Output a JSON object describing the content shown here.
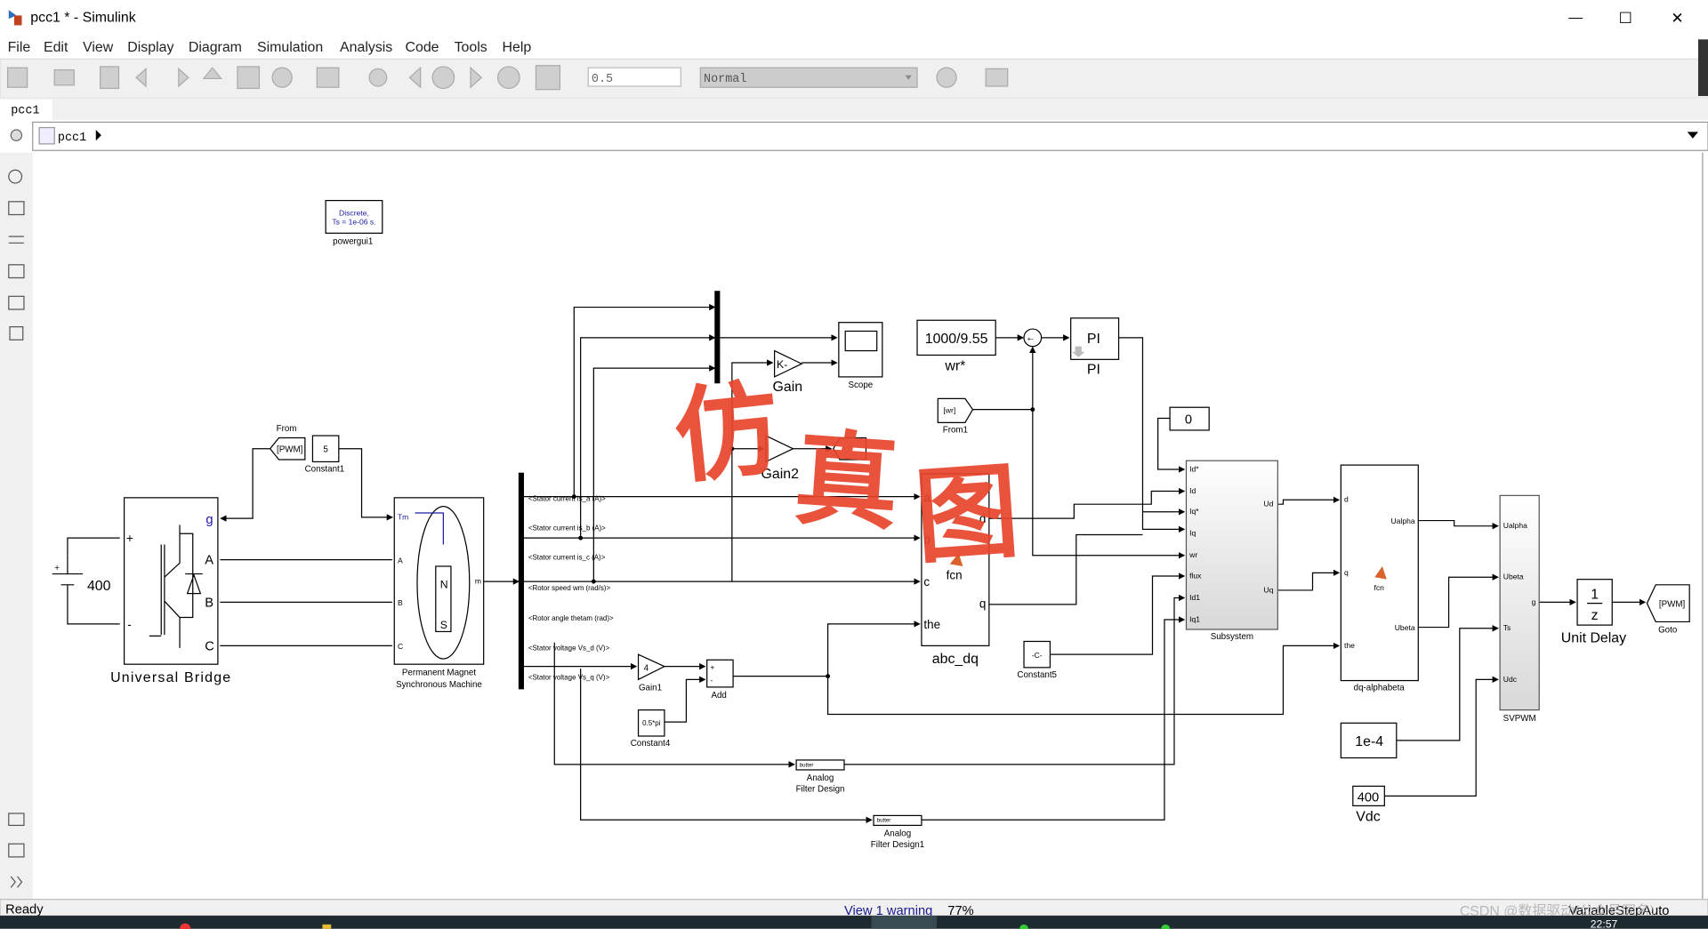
{
  "window": {
    "title": "pcc1 * - Simulink",
    "minimize": "—",
    "maximize": "☐",
    "close": "✕"
  },
  "menu": [
    "File",
    "Edit",
    "View",
    "Display",
    "Diagram",
    "Simulation",
    "Analysis",
    "Code",
    "Tools",
    "Help"
  ],
  "toolbar": {
    "stop_time": "0.5",
    "sim_mode": "Normal"
  },
  "tabs": [
    {
      "label": "pcc1"
    }
  ],
  "breadcrumb": {
    "model": "pcc1"
  },
  "status": {
    "left": "Ready",
    "warning": "View 1 warning",
    "zoom": "77%",
    "solver": "VariableStepAuto",
    "watermark": "CSDN @数据驱动(公众号同名)",
    "clock": "22:57"
  },
  "watermark_text": [
    "仿",
    "真",
    "图"
  ],
  "colors": {
    "accent_blue": "#1a1aa6",
    "watermark_red": "#e8452c",
    "taskbar": "#1d2a30"
  },
  "blocks": {
    "powergui": {
      "line1": "Discrete,",
      "line2": "Ts = 1e-06 s.",
      "label": "powergui1"
    },
    "dc": {
      "value": "400"
    },
    "bridge": {
      "label": "Universal Bridge",
      "ports": [
        "g",
        "A",
        "B",
        "C",
        "+",
        "-"
      ]
    },
    "from": {
      "tag": "[PWM]",
      "label": "From"
    },
    "constant1": {
      "value": "5",
      "label": "Constant1"
    },
    "pmsm": {
      "label1": "Permanent Magnet",
      "label2": "Synchronous Machine",
      "ports": [
        "Tm",
        "A",
        "B",
        "C",
        "m"
      ],
      "poles": [
        "N",
        "S"
      ]
    },
    "bus_signals": [
      "<Stator current is_a (A)>",
      "<Stator current is_b (A)>",
      "<Stator current is_c (A)>",
      "<Rotor speed wm (rad/s)>",
      "<Rotor angle thetam (rad)>",
      "<Stator voltage Vs_d (V)>",
      "<Stator voltage Vs_q (V)>"
    ],
    "scope": {
      "label": "Scope"
    },
    "gain": {
      "value": "K-",
      "label": "Gain"
    },
    "gain2": {
      "label": "Gain2"
    },
    "wr_ref": {
      "value": "1000/9.55",
      "label": "wr*"
    },
    "sum": {
      "signs": "+-"
    },
    "pi": {
      "value": "PI",
      "label": "PI"
    },
    "from1": {
      "tag": "[wr]",
      "label": "From1"
    },
    "zero": {
      "value": "0"
    },
    "abc_dq": {
      "label": "abc_dq",
      "fcn": "fcn",
      "inputs": [
        "a",
        "b",
        "c",
        "the"
      ],
      "outputs": [
        "d",
        "q"
      ]
    },
    "subsystem": {
      "label": "Subsystem",
      "inputs": [
        "Id*",
        "Id",
        "Iq*",
        "Iq",
        "wr",
        "flux",
        "Id1",
        "Iq1"
      ],
      "outputs": [
        "Ud",
        "Uq"
      ]
    },
    "dq_ab": {
      "label": "dq-alphabeta",
      "fcn": "fcn",
      "inputs": [
        "d",
        "q",
        "the"
      ],
      "outputs": [
        "Ualpha",
        "Ubeta"
      ]
    },
    "svpwm": {
      "label": "SVPWM",
      "inputs": [
        "Ualpha",
        "Ubeta",
        "Ts",
        "Udc"
      ],
      "output": "g"
    },
    "unit_delay": {
      "num": "1",
      "den": "z",
      "label": "Unit Delay"
    },
    "goto": {
      "tag": "[PWM]",
      "label": "Goto"
    },
    "ts_const": {
      "value": "1e-4"
    },
    "vdc": {
      "value": "400",
      "label": "Vdc"
    },
    "constant5": {
      "value": "-C-",
      "label": "Constant5"
    },
    "gain1": {
      "value": "4",
      "label": "Gain1"
    },
    "add": {
      "label": "Add",
      "signs": [
        "+",
        "-"
      ]
    },
    "constant4": {
      "value": "0.5*pi",
      "label": "Constant4"
    },
    "filter": {
      "label1": "Analog",
      "label2": "Filter Design",
      "tag": "butter"
    },
    "filter1": {
      "label1": "Analog",
      "label2": "Filter Design1",
      "tag": "butter"
    }
  }
}
